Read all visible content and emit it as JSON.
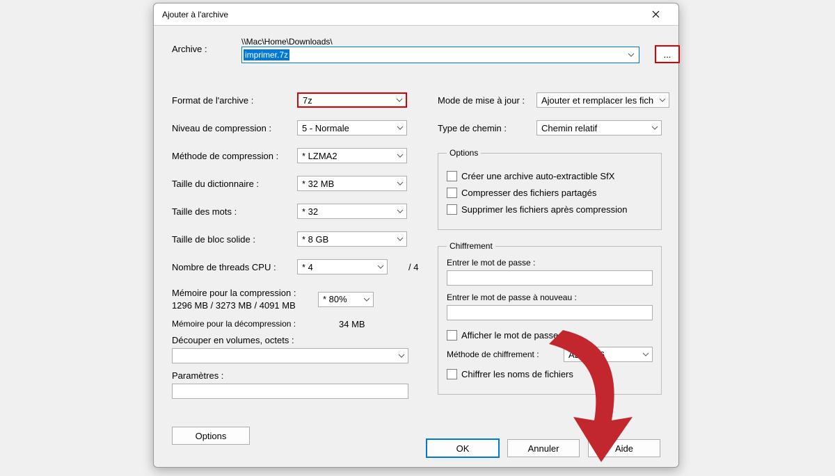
{
  "title": "Ajouter à l'archive",
  "archive": {
    "label": "Archive :",
    "path": "\\\\Mac\\Home\\Downloads\\",
    "filename": "imprimer.7z",
    "browse": "..."
  },
  "left": {
    "format": {
      "label": "Format de l'archive :",
      "value": "7z"
    },
    "level": {
      "label": "Niveau de compression :",
      "value": "5 - Normale"
    },
    "method": {
      "label": "Méthode de compression :",
      "value": "* LZMA2"
    },
    "dict": {
      "label": "Taille du dictionnaire :",
      "value": "* 32 MB"
    },
    "word": {
      "label": "Taille des mots :",
      "value": "* 32"
    },
    "block": {
      "label": "Taille de bloc solide :",
      "value": "* 8 GB"
    },
    "threads": {
      "label": "Nombre de threads CPU :",
      "value": "* 4",
      "total": "/ 4"
    },
    "mem_compress": {
      "label": "Mémoire pour la compression :",
      "detail": "1296 MB / 3273 MB / 4091 MB",
      "value": "* 80%"
    },
    "mem_decompress": {
      "label": "Mémoire pour la décompression :",
      "value": "34 MB"
    },
    "split": {
      "label": "Découper en volumes, octets :",
      "value": ""
    },
    "params": {
      "label": "Paramètres :",
      "value": ""
    },
    "options_btn": "Options"
  },
  "right": {
    "update": {
      "label": "Mode de mise à jour :",
      "value": "Ajouter et remplacer les fich"
    },
    "pathmode": {
      "label": "Type de chemin :",
      "value": "Chemin relatif"
    },
    "options_legend": "Options",
    "opt_sfx": "Créer une archive auto-extractible SfX",
    "opt_shared": "Compresser des fichiers partagés",
    "opt_delete": "Supprimer les fichiers après compression",
    "enc_legend": "Chiffrement",
    "enc_pwd": "Entrer le mot de passe :",
    "enc_pwd2": "Entrer le mot de passe à nouveau :",
    "enc_show": "Afficher le mot de passe",
    "enc_method": {
      "label": "Méthode de chiffrement :",
      "value": "AES-256"
    },
    "enc_names": "Chiffrer les noms de fichiers"
  },
  "buttons": {
    "ok": "OK",
    "cancel": "Annuler",
    "help": "Aide"
  }
}
